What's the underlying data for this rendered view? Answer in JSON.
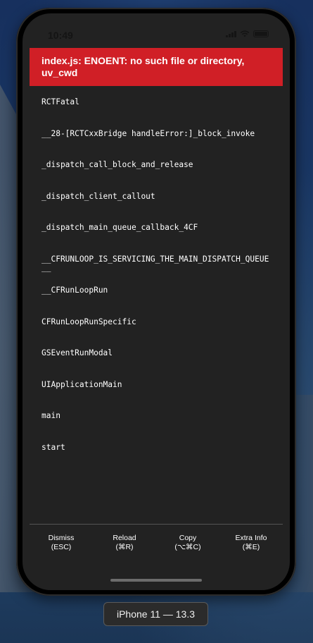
{
  "status_bar": {
    "time": "10:49",
    "icons": [
      "signal-icon",
      "wifi-icon",
      "battery-icon"
    ]
  },
  "error": {
    "message": "index.js: ENOENT: no such file or directory, uv_cwd",
    "color": "#d01f26"
  },
  "stack_frames": [
    "RCTFatal",
    "__28-[RCTCxxBridge handleError:]_block_invoke",
    "_dispatch_call_block_and_release",
    "_dispatch_client_callout",
    "_dispatch_main_queue_callback_4CF",
    "__CFRUNLOOP_IS_SERVICING_THE_MAIN_DISPATCH_QUEUE__",
    "__CFRunLoopRun",
    "CFRunLoopRunSpecific",
    "GSEventRunModal",
    "UIApplicationMain",
    "main",
    "start"
  ],
  "actions": [
    {
      "label": "Dismiss",
      "shortcut": "(ESC)"
    },
    {
      "label": "Reload",
      "shortcut": "(⌘R)"
    },
    {
      "label": "Copy",
      "shortcut": "(⌥⌘C)"
    },
    {
      "label": "Extra Info",
      "shortcut": "(⌘E)"
    }
  ],
  "device_label": "iPhone 11 — 13.3"
}
